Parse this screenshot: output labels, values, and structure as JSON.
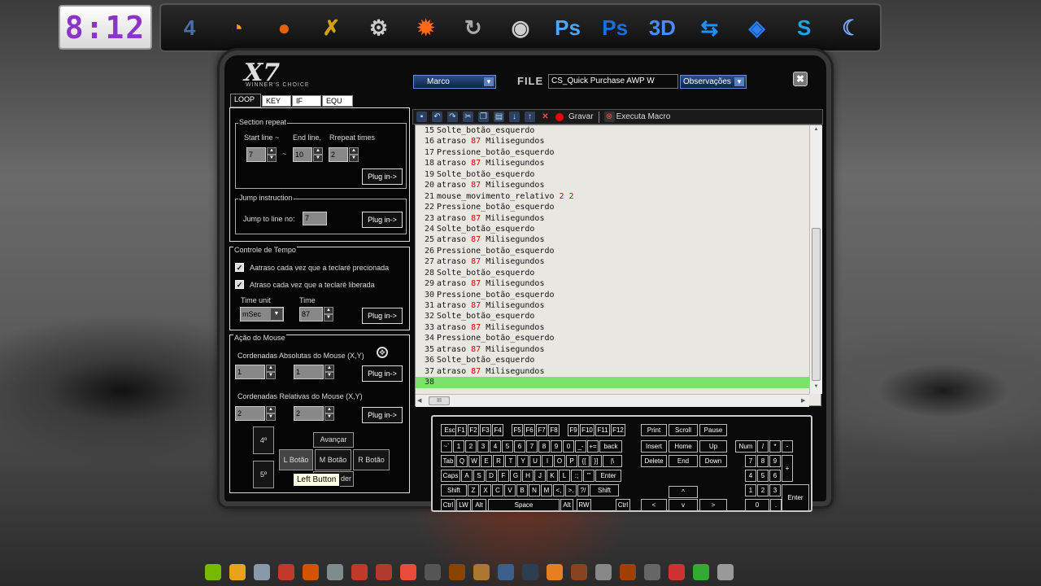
{
  "clock": "8:12",
  "dock": [
    {
      "icon": "windows-4-icon",
      "glyph": "4",
      "color": "#4a6fa8"
    },
    {
      "icon": "basketball-icon",
      "glyph": "◔",
      "color": "#ff9a00"
    },
    {
      "icon": "firefox-icon",
      "glyph": "●",
      "color": "#e2620c"
    },
    {
      "icon": "trophy-icon",
      "glyph": "✗",
      "color": "#d4a30a"
    },
    {
      "icon": "film-camera-icon",
      "glyph": "⚙",
      "color": "#cccccc"
    },
    {
      "icon": "puzzle-gear-icon",
      "glyph": "✹",
      "color": "#ff6a1a"
    },
    {
      "icon": "refresh-ring-icon",
      "glyph": "↻",
      "color": "#aaaaaa"
    },
    {
      "icon": "steam-icon",
      "glyph": "◉",
      "color": "#cfcfcf"
    },
    {
      "icon": "photoshop-icon-1",
      "glyph": "Ps",
      "color": "#4aa7ff"
    },
    {
      "icon": "photoshop-icon-2",
      "glyph": "Ps",
      "color": "#1a6ee0"
    },
    {
      "icon": "3d-icon",
      "glyph": "3D",
      "color": "#4a8cff"
    },
    {
      "icon": "teamviewer-icon",
      "glyph": "⇆",
      "color": "#1e90ff"
    },
    {
      "icon": "media-player-icon",
      "glyph": "◈",
      "color": "#2d7ef0"
    },
    {
      "icon": "skype-icon",
      "glyph": "S",
      "color": "#1fa4e8"
    },
    {
      "icon": "crescent-app-icon",
      "glyph": "☾",
      "color": "#7aa6ff"
    }
  ],
  "window": {
    "brand": "X7",
    "brand_sub": "WINNER'S CHOICE",
    "marco_label": "Marco",
    "file_label": "FILE",
    "file_name": "CS_Quick Purchase AWP W",
    "obs_label": "Observações",
    "close": "✖"
  },
  "tabs": [
    "LOOP",
    "KEY",
    "IF",
    "EQU"
  ],
  "section_repeat": {
    "title": "Section repeat",
    "start_label": "Start line  ~",
    "end_label": "End line,",
    "times_label": "Rrepeat times",
    "start": "7",
    "tilde": "~",
    "end": "10",
    "times": "2",
    "plugin": "Plug in->"
  },
  "jump": {
    "title": "Jump instruction",
    "label": "Jump to line no:",
    "value": "7",
    "plugin": "Plug in->"
  },
  "tempo": {
    "title": "Controle de Tempo",
    "chk1": "Aatraso cada vez que a teclaré precionada",
    "chk2": "Atraso cada vez que a teclaré liberada",
    "unit_label": "Time unit",
    "unit": "mSec",
    "time_label": "Time",
    "time": "87",
    "plugin": "Plug in->"
  },
  "mouse": {
    "title": "Ação do Mouse",
    "abs_label": "Cordenadas Absolutas do Mouse (X,Y)",
    "abs_x": "1",
    "abs_y": "1",
    "rel_label": "Cordenadas Relativas do Mouse (X,Y)",
    "rel_x": "2",
    "rel_y": "2",
    "plugin": "Plug in->",
    "btn_4": "4º",
    "btn_5": "5º",
    "avancar": "Avançar",
    "l_botao": "L Botão",
    "m_botao": "M Botão",
    "r_botao": "R Botão",
    "under": "der",
    "tooltip": "Left Button"
  },
  "toolbar": {
    "gravar": "Gravar",
    "executa": "Executa Macro"
  },
  "editor": {
    "lines": [
      {
        "n": "15",
        "parts": [
          {
            "t": "Solte_botão_esquerdo"
          }
        ]
      },
      {
        "n": "16",
        "parts": [
          {
            "t": "atraso "
          },
          {
            "t": "87",
            "r": true
          },
          {
            "t": " Milisegundos"
          }
        ]
      },
      {
        "n": "17",
        "parts": [
          {
            "t": "Pressione_botão_esquerdo"
          }
        ]
      },
      {
        "n": "18",
        "parts": [
          {
            "t": "atraso "
          },
          {
            "t": "87",
            "r": true
          },
          {
            "t": " Milisegundos"
          }
        ]
      },
      {
        "n": "19",
        "parts": [
          {
            "t": "Solte_botão_esquerdo"
          }
        ]
      },
      {
        "n": "20",
        "parts": [
          {
            "t": "atraso "
          },
          {
            "t": "87",
            "r": true
          },
          {
            "t": " Milisegundos"
          }
        ]
      },
      {
        "n": "21",
        "parts": [
          {
            "t": "mouse_movimento_relativo "
          },
          {
            "t": "2 2",
            "r": true
          }
        ]
      },
      {
        "n": "22",
        "parts": [
          {
            "t": "Pressione_botão_esquerdo"
          }
        ]
      },
      {
        "n": "23",
        "parts": [
          {
            "t": "atraso "
          },
          {
            "t": "87",
            "r": true
          },
          {
            "t": " Milisegundos"
          }
        ]
      },
      {
        "n": "24",
        "parts": [
          {
            "t": "Solte_botão_esquerdo"
          }
        ]
      },
      {
        "n": "25",
        "parts": [
          {
            "t": "atraso "
          },
          {
            "t": "87",
            "r": true
          },
          {
            "t": " Milisegundos"
          }
        ]
      },
      {
        "n": "26",
        "parts": [
          {
            "t": "Pressione_botão_esquerdo"
          }
        ]
      },
      {
        "n": "27",
        "parts": [
          {
            "t": "atraso "
          },
          {
            "t": "87",
            "r": true
          },
          {
            "t": " Milisegundos"
          }
        ]
      },
      {
        "n": "28",
        "parts": [
          {
            "t": "Solte_botão_esquerdo"
          }
        ]
      },
      {
        "n": "29",
        "parts": [
          {
            "t": "atraso "
          },
          {
            "t": "87",
            "r": true
          },
          {
            "t": " Milisegundos"
          }
        ]
      },
      {
        "n": "30",
        "parts": [
          {
            "t": "Pressione_botão_esquerdo"
          }
        ]
      },
      {
        "n": "31",
        "parts": [
          {
            "t": "atraso "
          },
          {
            "t": "87",
            "r": true
          },
          {
            "t": " Milisegundos"
          }
        ]
      },
      {
        "n": "32",
        "parts": [
          {
            "t": "Solte_botão_esquerdo"
          }
        ]
      },
      {
        "n": "33",
        "parts": [
          {
            "t": "atraso "
          },
          {
            "t": "87",
            "r": true
          },
          {
            "t": " Milisegundos"
          }
        ]
      },
      {
        "n": "34",
        "parts": [
          {
            "t": "Pressione_botão_esquerdo"
          }
        ]
      },
      {
        "n": "35",
        "parts": [
          {
            "t": "atraso "
          },
          {
            "t": "87",
            "r": true
          },
          {
            "t": " Milisegundos"
          }
        ]
      },
      {
        "n": "36",
        "parts": [
          {
            "t": "Solte_botão_esquerdo"
          }
        ]
      },
      {
        "n": "37",
        "parts": [
          {
            "t": "atraso "
          },
          {
            "t": "87",
            "r": true
          },
          {
            "t": " Milisegundos"
          }
        ]
      },
      {
        "n": "38",
        "parts": [
          {
            "t": ""
          }
        ],
        "hl": true
      }
    ],
    "hscroll": "III"
  },
  "keyboard": {
    "rows": [
      [
        "Esc",
        "F1",
        "F2",
        "F3",
        "F4",
        "F5",
        "F6",
        "F7",
        "F8",
        "F9",
        "F10",
        "F11",
        "F12",
        "Print",
        "Scroll",
        "Pause"
      ],
      [
        "~`",
        "1",
        "2",
        "3",
        "4",
        "5",
        "6",
        "7",
        "8",
        "9",
        "0",
        "_-",
        "+=",
        "back",
        "Insert",
        "Home",
        "Up",
        "Num",
        "/",
        "*",
        "-"
      ],
      [
        "Tab",
        "Q",
        "W",
        "E",
        "R",
        "T",
        "Y",
        "U",
        "I",
        "O",
        "P",
        "{[",
        "}]",
        "|\\",
        "Delete",
        "End",
        "Down",
        "7",
        "8",
        "9",
        "+"
      ],
      [
        "Caps",
        "A",
        "S",
        "D",
        "F",
        "G",
        "H",
        "J",
        "K",
        "L",
        ":;",
        "\"'",
        "Enter",
        "4",
        "5",
        "6"
      ],
      [
        "Shift",
        "Z",
        "X",
        "C",
        "V",
        "B",
        "N",
        "M",
        "<,",
        ">.",
        "?/",
        "Shift",
        "^",
        "1",
        "2",
        "3",
        "Enter"
      ],
      [
        "Ctrl",
        "LW",
        "Alt",
        "Space",
        "Alt",
        "RW",
        "Ctrl",
        "<",
        "v",
        ">",
        "0",
        "."
      ]
    ]
  },
  "taskbar": [
    {
      "icon": "nvidia-taskbar-icon",
      "color": "#76b900"
    },
    {
      "icon": "windows-flag-taskbar-icon",
      "color": "#e8a31c"
    },
    {
      "icon": "recycle-taskbar-icon",
      "color": "#8899aa"
    },
    {
      "icon": "app-taskbar-icon-1",
      "color": "#c0392b"
    },
    {
      "icon": "app-taskbar-icon-2",
      "color": "#d35400"
    },
    {
      "icon": "app-taskbar-icon-3",
      "color": "#7f8c8d"
    },
    {
      "icon": "app-taskbar-icon-4",
      "color": "#c0392b"
    },
    {
      "icon": "app-taskbar-icon-5",
      "color": "#b03a2e"
    },
    {
      "icon": "app-taskbar-icon-6",
      "color": "#e74c3c"
    },
    {
      "icon": "app-taskbar-icon-7",
      "color": "#555555"
    },
    {
      "icon": "app-taskbar-icon-8",
      "color": "#884400"
    },
    {
      "icon": "app-taskbar-icon-9",
      "color": "#aa7733"
    },
    {
      "icon": "app-taskbar-icon-10",
      "color": "#3a5f8a"
    },
    {
      "icon": "app-taskbar-icon-11",
      "color": "#2c3e50"
    },
    {
      "icon": "app-taskbar-icon-12",
      "color": "#e67e22"
    },
    {
      "icon": "app-taskbar-icon-13",
      "color": "#884422"
    },
    {
      "icon": "app-taskbar-icon-14",
      "color": "#888888"
    },
    {
      "icon": "app-taskbar-icon-15",
      "color": "#a04000"
    },
    {
      "icon": "app-taskbar-icon-16",
      "color": "#666666"
    },
    {
      "icon": "app-taskbar-icon-17",
      "color": "#cc3333"
    },
    {
      "icon": "app-taskbar-icon-18",
      "color": "#33aa33"
    },
    {
      "icon": "app-taskbar-icon-19",
      "color": "#999999"
    }
  ]
}
